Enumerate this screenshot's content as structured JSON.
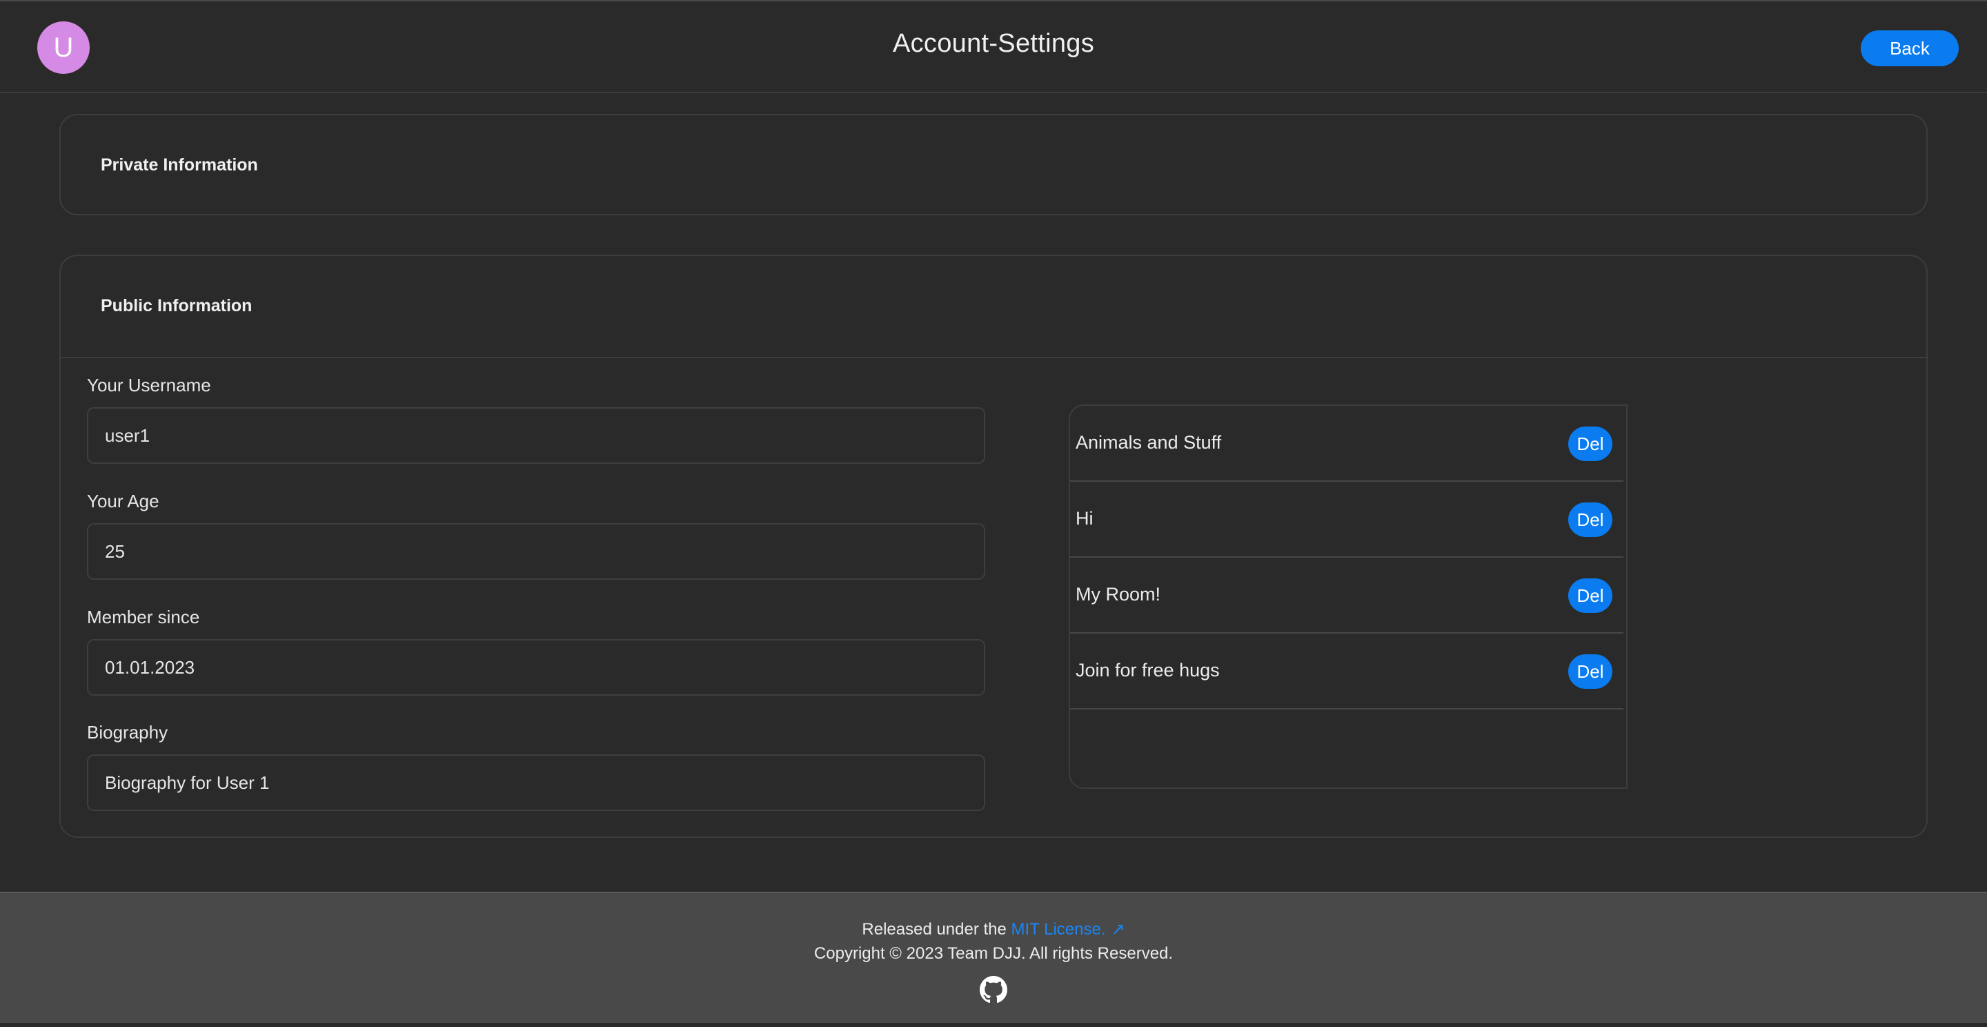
{
  "header": {
    "avatar_initial": "U",
    "title": "Account-Settings",
    "back_label": "Back"
  },
  "private_card": {
    "heading": "Private Information"
  },
  "public_card": {
    "heading": "Public Information",
    "fields": [
      {
        "label": "Your Username",
        "value": "user1"
      },
      {
        "label": "Your Age",
        "value": "25"
      },
      {
        "label": "Member since",
        "value": "01.01.2023"
      },
      {
        "label": "Biography",
        "value": "Biography for User 1"
      }
    ],
    "rooms": [
      {
        "name": "Animals and Stuff",
        "action": "Del"
      },
      {
        "name": "Hi",
        "action": "Del"
      },
      {
        "name": "My Room!",
        "action": "Del"
      },
      {
        "name": "Join for free hugs",
        "action": "Del"
      }
    ]
  },
  "footer": {
    "released_prefix": "Released under the ",
    "license_link": "MIT License.",
    "external_icon": "arrow-up-right-icon",
    "copyright": "Copyright © 2023 Team DJJ. All rights Reserved.",
    "social_icon": "github-icon"
  },
  "colors": {
    "background": "#2a2a2a",
    "accent": "#0a7cf0",
    "avatar": "#d58ae6",
    "footer": "#494949"
  }
}
